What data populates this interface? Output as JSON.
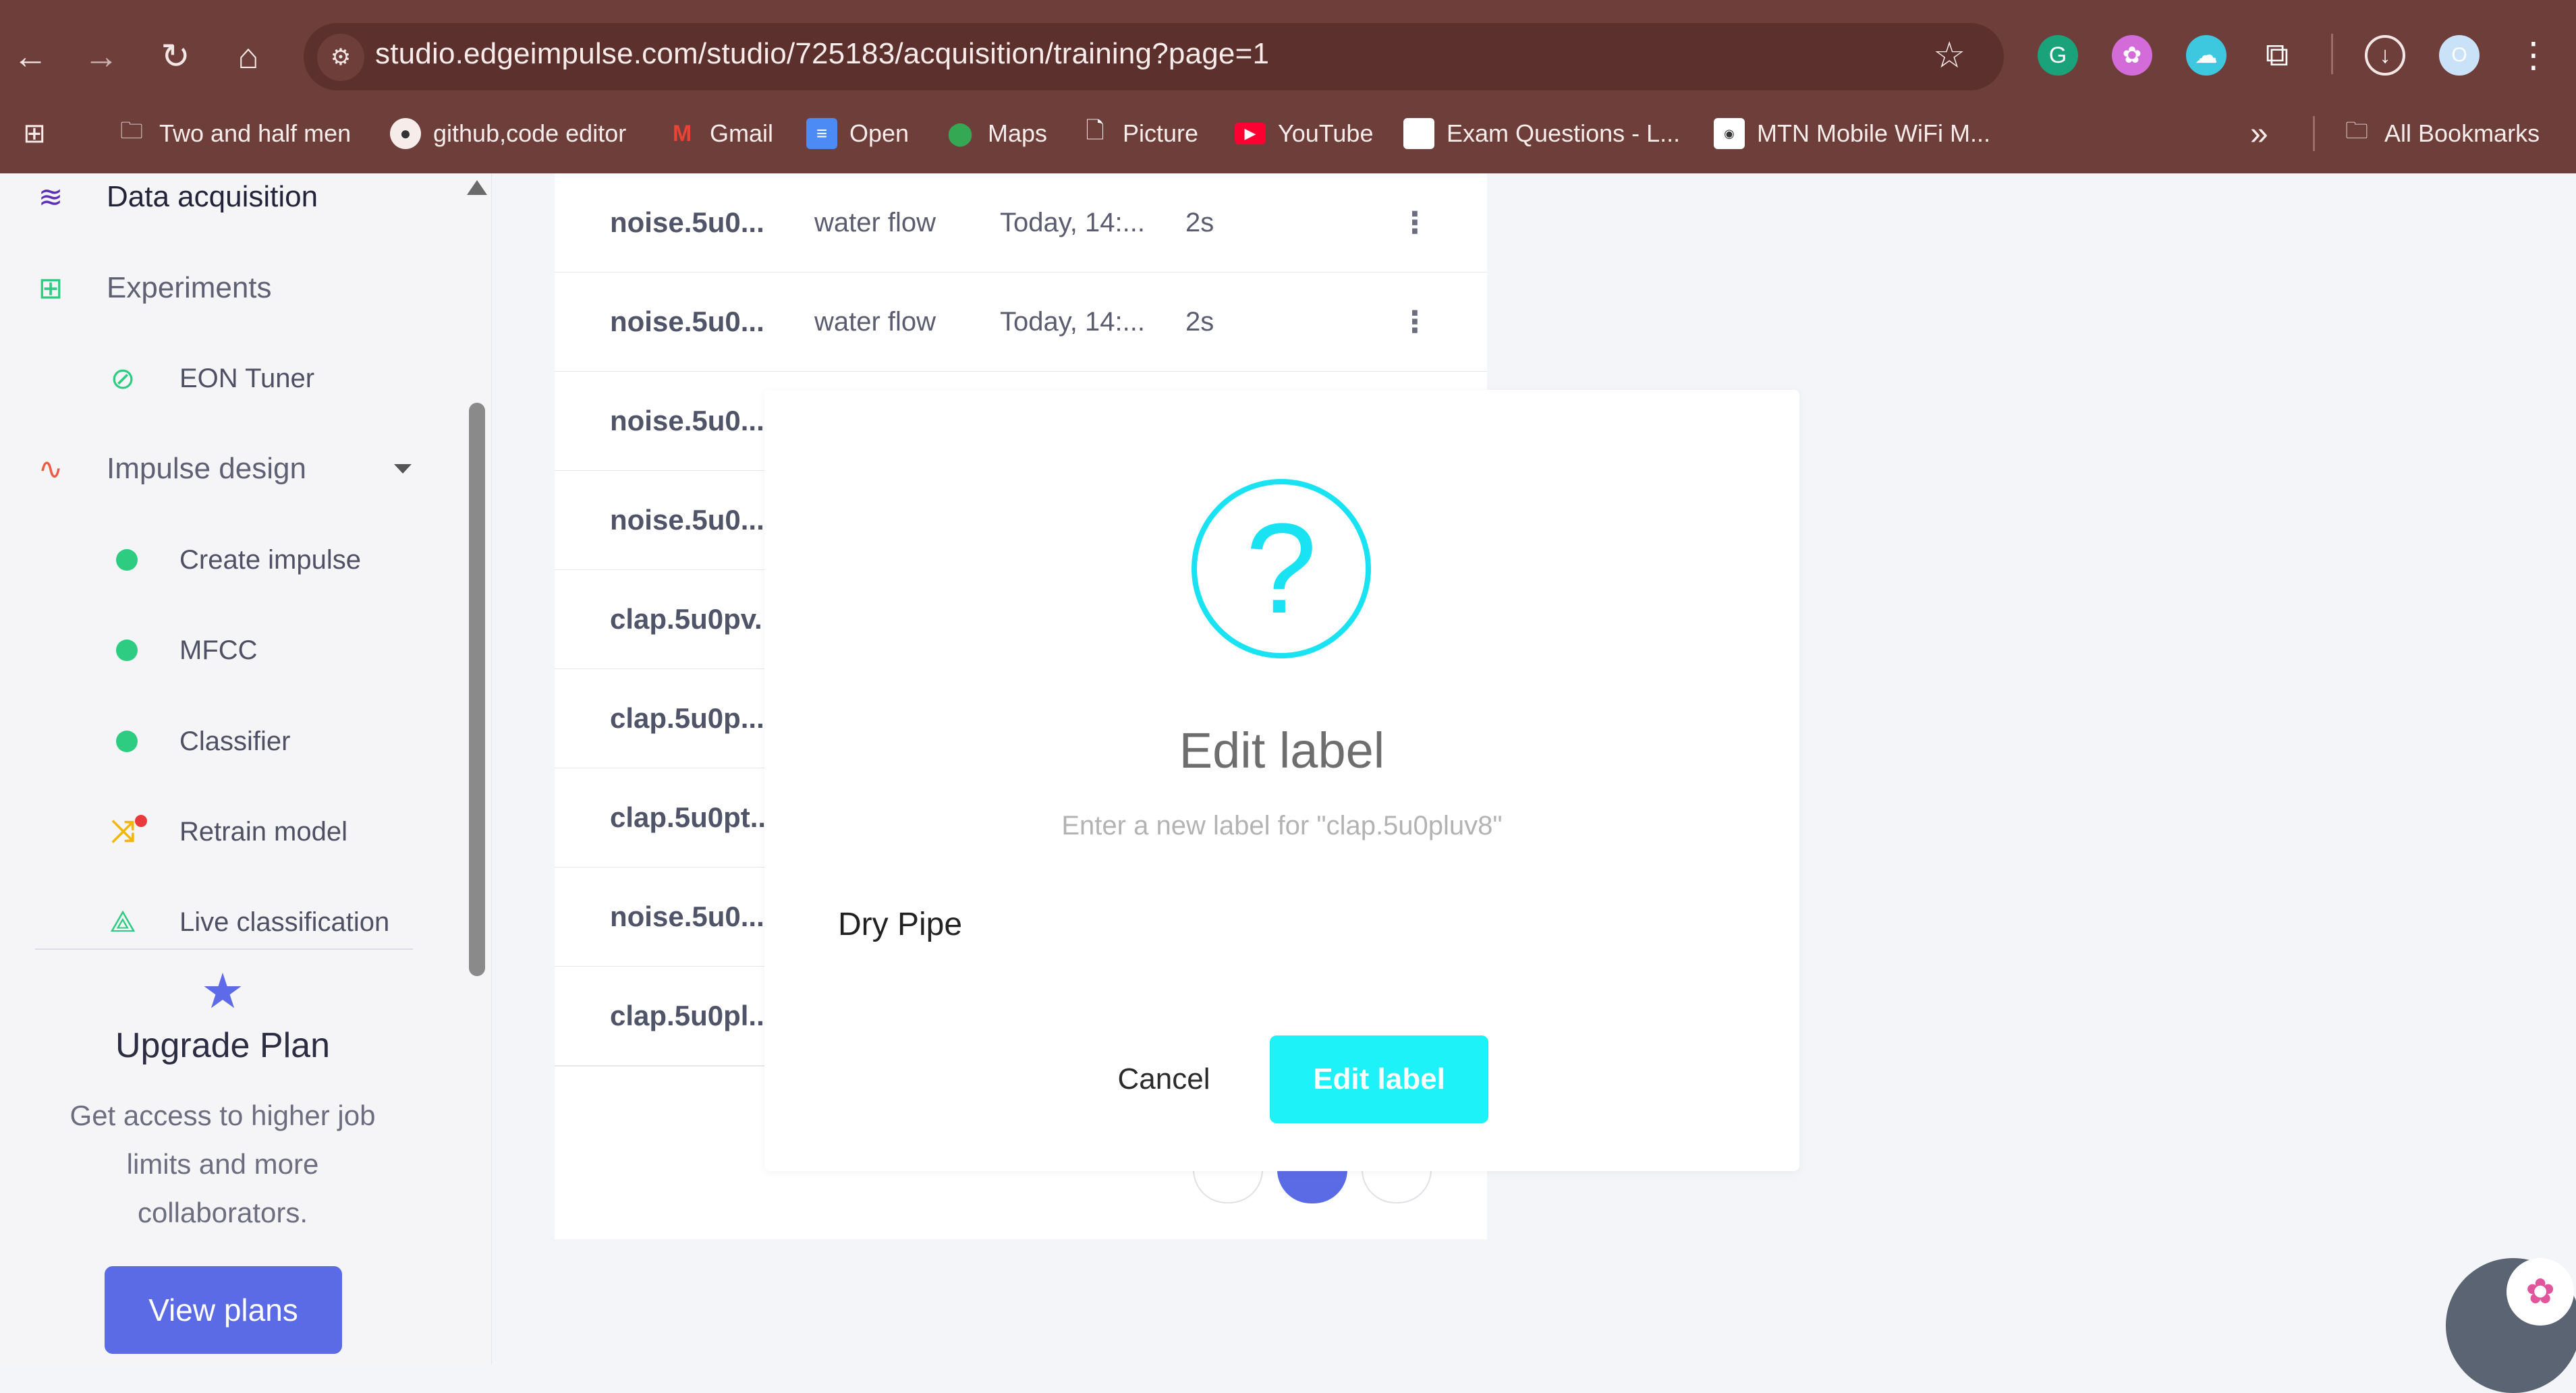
{
  "browser": {
    "url": "studio.edgeimpulse.com/studio/725183/acquisition/training?page=1",
    "profile_initial": "O",
    "bookmarks": [
      {
        "label": "Two and half men",
        "icon": "folder-icon"
      },
      {
        "label": "github,code editor",
        "icon": "github-icon"
      },
      {
        "label": "Gmail",
        "icon": "gmail-icon"
      },
      {
        "label": "Open",
        "icon": "docs-icon"
      },
      {
        "label": "Maps",
        "icon": "maps-icon"
      },
      {
        "label": "Picture",
        "icon": "file-icon"
      },
      {
        "label": "YouTube",
        "icon": "youtube-icon"
      },
      {
        "label": "Exam Questions - L...",
        "icon": "page-icon"
      },
      {
        "label": "MTN Mobile WiFi M...",
        "icon": "mtn-icon"
      }
    ],
    "overflow": "»",
    "all_bookmarks": "All Bookmarks"
  },
  "sidebar": {
    "items": [
      {
        "label": "Data acquisition",
        "icon": "database-icon"
      },
      {
        "label": "Experiments",
        "icon": "table-icon"
      },
      {
        "label": "EON Tuner",
        "icon": "compass-icon"
      },
      {
        "label": "Impulse design",
        "icon": "pulse-icon"
      },
      {
        "label": "Create impulse",
        "icon": "dot-icon"
      },
      {
        "label": "MFCC",
        "icon": "dot-icon"
      },
      {
        "label": "Classifier",
        "icon": "dot-icon"
      },
      {
        "label": "Retrain model",
        "icon": "shuffle-icon"
      },
      {
        "label": "Live classification",
        "icon": "network-icon"
      }
    ],
    "upgrade": {
      "title": "Upgrade Plan",
      "text": "Get access to higher job limits and more collaborators.",
      "button": "View plans"
    }
  },
  "table": {
    "rows": [
      {
        "name": "noise.5u0...",
        "label": "water flow",
        "time": "Today, 14:...",
        "duration": "2s"
      },
      {
        "name": "noise.5u0...",
        "label": "water flow",
        "time": "Today, 14:...",
        "duration": "2s"
      },
      {
        "name": "noise.5u0...",
        "label": "",
        "time": "",
        "duration": ""
      },
      {
        "name": "noise.5u0...",
        "label": "",
        "time": "",
        "duration": ""
      },
      {
        "name": "clap.5u0pv.",
        "label": "",
        "time": "",
        "duration": ""
      },
      {
        "name": "clap.5u0p...",
        "label": "",
        "time": "",
        "duration": ""
      },
      {
        "name": "clap.5u0pt..",
        "label": "",
        "time": "",
        "duration": ""
      },
      {
        "name": "noise.5u0...",
        "label": "",
        "time": "",
        "duration": ""
      },
      {
        "name": "clap.5u0pl..",
        "label": "",
        "time": "",
        "duration": ""
      }
    ]
  },
  "modal": {
    "icon": "question-icon",
    "icon_glyph": "?",
    "title": "Edit label",
    "subtitle": "Enter a new label for \"clap.5u0pluv8\"",
    "input_value": "Dry Pipe",
    "cancel": "Cancel",
    "confirm": "Edit label"
  },
  "colors": {
    "browser_chrome": "#6e3e3b",
    "accent_cyan": "#1cf2f8",
    "primary_blue": "#5b6be6",
    "green_dot": "#2ecc81"
  }
}
